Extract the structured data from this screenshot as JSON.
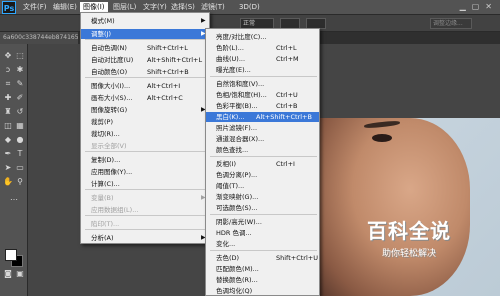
{
  "menubar": {
    "logo": "Ps",
    "items": [
      "文件(F)",
      "编辑(E)",
      "图像(I)",
      "图层(L)",
      "文字(Y)",
      "选择(S)",
      "滤镜(T)",
      "3D(D)"
    ]
  },
  "options_bar": {
    "mode_value": "正常",
    "adjust_edge": "调整边缘..."
  },
  "document_tab": "6a600c338744eb874165",
  "image_menu": [
    {
      "label": "模式(M)",
      "shortcut": "",
      "submenu": true
    },
    {
      "label": "调整(J)",
      "shortcut": "",
      "submenu": true,
      "highlight": true
    },
    {
      "label": "自动色调(N)",
      "shortcut": "Shift+Ctrl+L"
    },
    {
      "label": "自动对比度(U)",
      "shortcut": "Alt+Shift+Ctrl+L"
    },
    {
      "label": "自动颜色(O)",
      "shortcut": "Shift+Ctrl+B"
    },
    {
      "label": "图像大小(I)...",
      "shortcut": "Alt+Ctrl+I"
    },
    {
      "label": "画布大小(S)...",
      "shortcut": "Alt+Ctrl+C"
    },
    {
      "label": "图像旋转(G)",
      "shortcut": "",
      "submenu": true
    },
    {
      "label": "裁剪(P)",
      "shortcut": ""
    },
    {
      "label": "裁切(R)...",
      "shortcut": ""
    },
    {
      "label": "显示全部(V)",
      "shortcut": "",
      "disabled": true
    },
    {
      "label": "复制(D)...",
      "shortcut": ""
    },
    {
      "label": "应用图像(Y)...",
      "shortcut": ""
    },
    {
      "label": "计算(C)...",
      "shortcut": ""
    },
    {
      "label": "变量(B)",
      "shortcut": "",
      "submenu": true,
      "disabled": true
    },
    {
      "label": "应用数据组(L)...",
      "shortcut": "",
      "disabled": true
    },
    {
      "label": "陷印(T)...",
      "shortcut": "",
      "disabled": true
    },
    {
      "label": "分析(A)",
      "shortcut": "",
      "submenu": true
    }
  ],
  "adjust_menu": [
    {
      "label": "亮度/对比度(C)...",
      "shortcut": ""
    },
    {
      "label": "色阶(L)...",
      "shortcut": "Ctrl+L"
    },
    {
      "label": "曲线(U)...",
      "shortcut": "Ctrl+M"
    },
    {
      "label": "曝光度(E)...",
      "shortcut": ""
    },
    {
      "label": "自然饱和度(V)...",
      "shortcut": ""
    },
    {
      "label": "色相/饱和度(H)...",
      "shortcut": "Ctrl+U"
    },
    {
      "label": "色彩平衡(B)...",
      "shortcut": "Ctrl+B"
    },
    {
      "label": "黑白(K)...",
      "shortcut": "Alt+Shift+Ctrl+B",
      "highlight": true
    },
    {
      "label": "照片滤镜(F)...",
      "shortcut": ""
    },
    {
      "label": "通道混合器(X)...",
      "shortcut": ""
    },
    {
      "label": "颜色查找...",
      "shortcut": ""
    },
    {
      "label": "反相(I)",
      "shortcut": "Ctrl+I"
    },
    {
      "label": "色调分离(P)...",
      "shortcut": ""
    },
    {
      "label": "阈值(T)...",
      "shortcut": ""
    },
    {
      "label": "渐变映射(G)...",
      "shortcut": ""
    },
    {
      "label": "可选颜色(S)...",
      "shortcut": ""
    },
    {
      "label": "阴影/高光(W)...",
      "shortcut": ""
    },
    {
      "label": "HDR 色调...",
      "shortcut": ""
    },
    {
      "label": "变化...",
      "shortcut": ""
    },
    {
      "label": "去色(D)",
      "shortcut": "Shift+Ctrl+U"
    },
    {
      "label": "匹配颜色(M)...",
      "shortcut": ""
    },
    {
      "label": "替换颜色(R)...",
      "shortcut": ""
    },
    {
      "label": "色调均化(Q)",
      "shortcut": ""
    }
  ],
  "watermark": {
    "title": "百科全说",
    "subtitle": "助你轻松解决"
  }
}
